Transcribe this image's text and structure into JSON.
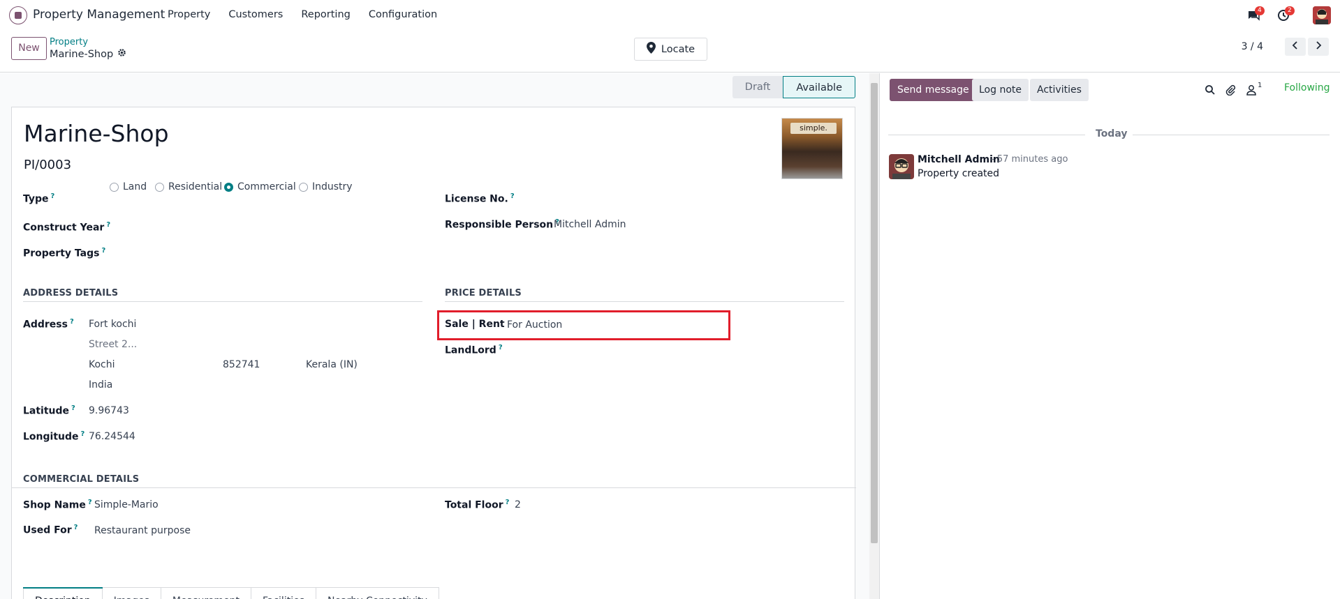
{
  "app": {
    "name": "Property Management",
    "menu": [
      "Property",
      "Customers",
      "Reporting",
      "Configuration"
    ],
    "badges": {
      "messages": "4",
      "activities": "2"
    }
  },
  "control": {
    "new_label": "New",
    "breadcrumb_parent": "Property",
    "breadcrumb_current": "Marine-Shop",
    "locate_label": "Locate",
    "pager": "3 / 4"
  },
  "statusbar": {
    "draft": "Draft",
    "available": "Available",
    "active": "Available"
  },
  "record": {
    "title": "Marine-Shop",
    "reference": "PI/0003",
    "thumb_sign": "simple.",
    "type_label": "Type",
    "type_options": [
      "Land",
      "Residential",
      "Commercial",
      "Industry"
    ],
    "type_selected": "Commercial",
    "construct_year_label": "Construct Year",
    "property_tags_label": "Property Tags",
    "license_label": "License No.",
    "responsible_label": "Responsible Person",
    "responsible_value": "Mitchell Admin",
    "address_section": "ADDRESS DETAILS",
    "address_label": "Address",
    "street": "Fort kochi",
    "street2": "Street 2...",
    "city": "Kochi",
    "zip": "852741",
    "state": "Kerala (IN)",
    "country": "India",
    "latitude_label": "Latitude",
    "latitude_value": "9.96743",
    "longitude_label": "Longitude",
    "longitude_value": "76.24544",
    "price_section": "PRICE DETAILS",
    "sale_rent_label": "Sale | Rent",
    "sale_rent_value": "For Auction",
    "landlord_label": "LandLord",
    "commercial_section": "COMMERCIAL DETAILS",
    "shop_name_label": "Shop Name",
    "shop_name_value": "Simple-Mario",
    "used_for_label": "Used For",
    "used_for_value": "Restaurant purpose",
    "total_floor_label": "Total Floor",
    "total_floor_value": "2",
    "help_mark": "?"
  },
  "tabs": [
    "Description",
    "Images",
    "Measurement",
    "Facilities",
    "Nearby Connectivity"
  ],
  "chatter": {
    "send_message": "Send message",
    "log_note": "Log note",
    "activities": "Activities",
    "followers_count": "1",
    "following": "Following",
    "date_separator": "Today",
    "message": {
      "author": "Mitchell Admin",
      "time": "- 57 minutes ago",
      "body": "Property created"
    }
  },
  "colors": {
    "brand": "#7c5270",
    "accent": "#017e84",
    "highlight": "#e11d2b",
    "following": "#28a745"
  }
}
